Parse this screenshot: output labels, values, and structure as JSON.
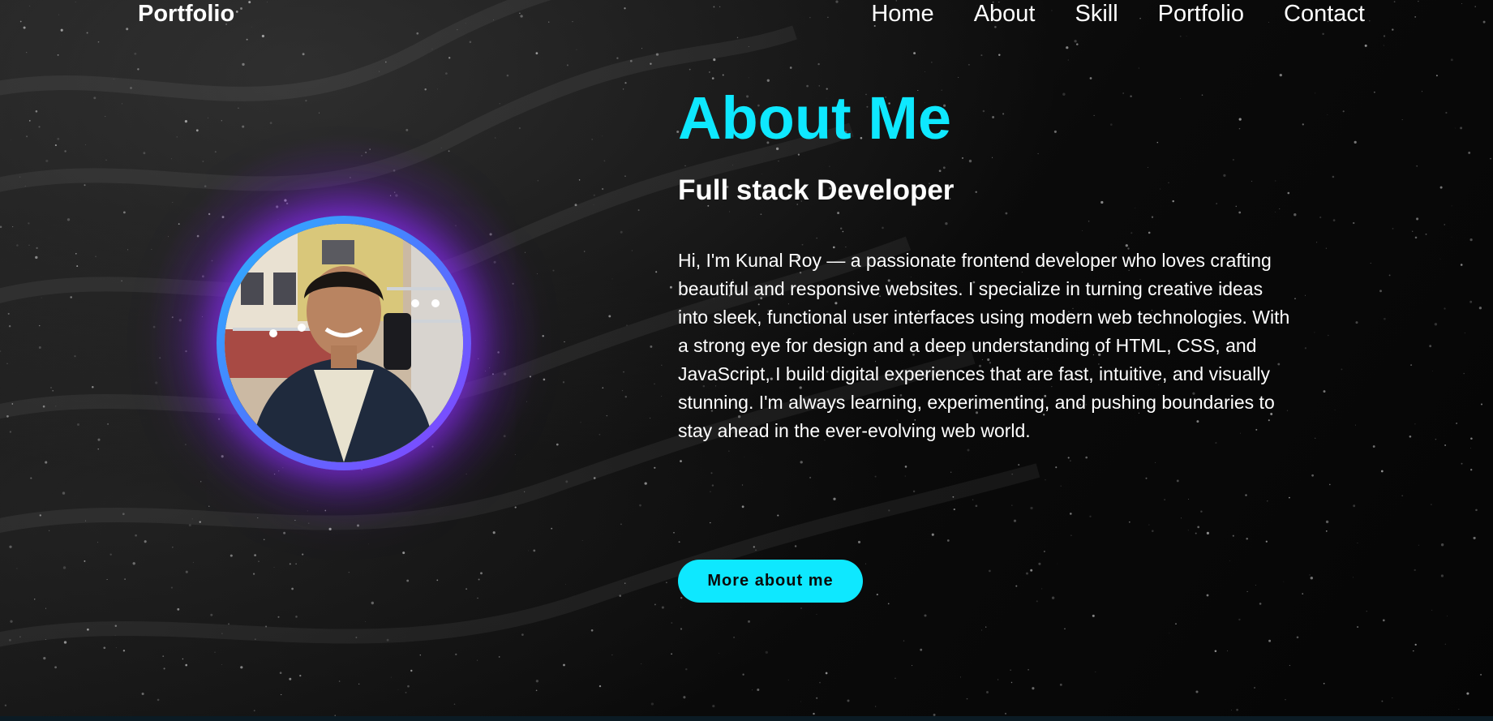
{
  "header": {
    "logo": "Portfolio",
    "nav": [
      "Home",
      "About",
      "Skill",
      "Portfolio",
      "Contact"
    ]
  },
  "about": {
    "title": "About Me",
    "subtitle": "Full stack Developer",
    "bio": "Hi, I'm Kunal Roy — a passionate frontend developer who loves crafting beautiful and responsive websites. I specialize in turning creative ideas into sleek, functional user interfaces using modern web technologies. With a strong eye for design and a deep understanding of HTML, CSS, and JavaScript, I build digital experiences that are fast, intuitive, and visually stunning. I'm always learning, experimenting, and pushing boundaries to stay ahead in the ever-evolving web world.",
    "button_label": "More about me"
  },
  "colors": {
    "accent": "#0ee8ff",
    "glow": "#8a3dff",
    "background": "#0b0b0b",
    "text": "#ffffff"
  }
}
